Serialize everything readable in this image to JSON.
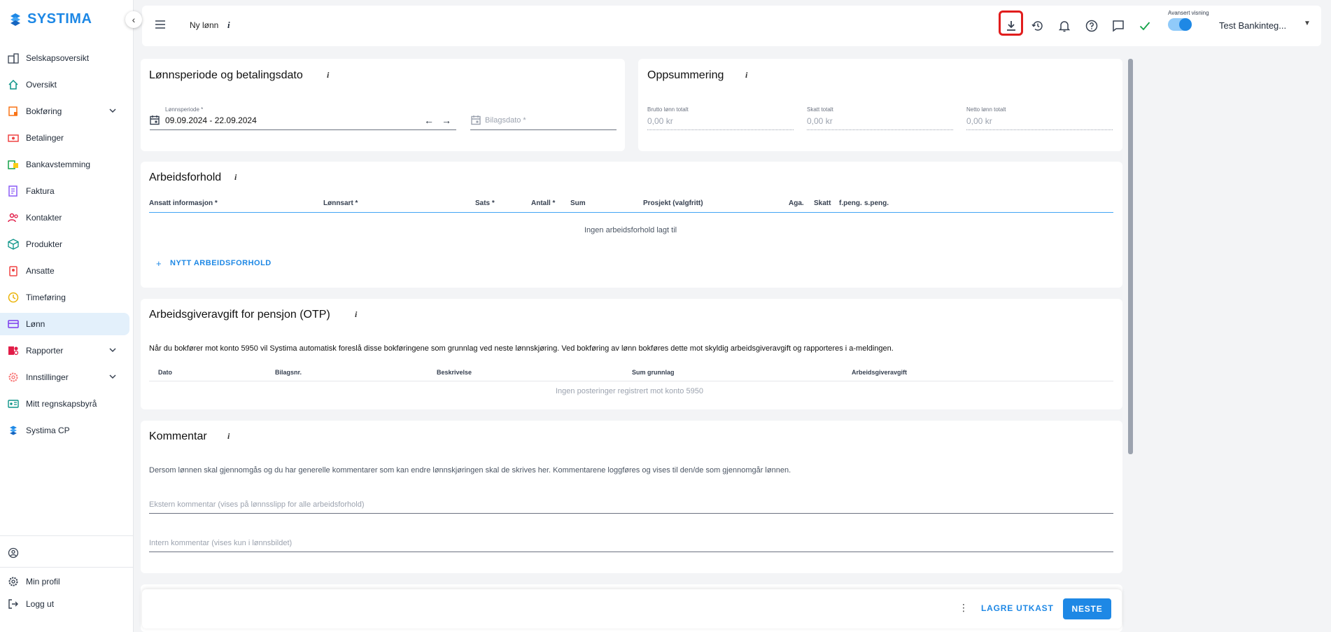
{
  "app": {
    "logo_text": "SYSTIMA"
  },
  "sidebar": {
    "items": [
      {
        "label": "Selskapsoversikt",
        "icon": "building-icon"
      },
      {
        "label": "Oversikt",
        "icon": "home-icon"
      },
      {
        "label": "Bokføring",
        "icon": "bookkeeping-icon",
        "expandable": true
      },
      {
        "label": "Betalinger",
        "icon": "payments-icon"
      },
      {
        "label": "Bankavstemming",
        "icon": "bank-icon"
      },
      {
        "label": "Faktura",
        "icon": "invoice-icon"
      },
      {
        "label": "Kontakter",
        "icon": "contacts-icon"
      },
      {
        "label": "Produkter",
        "icon": "product-box-icon"
      },
      {
        "label": "Ansatte",
        "icon": "employee-badge-icon"
      },
      {
        "label": "Timeføring",
        "icon": "clock-icon"
      },
      {
        "label": "Lønn",
        "icon": "card-icon",
        "active": true
      },
      {
        "label": "Rapporter",
        "icon": "reports-icon",
        "expandable": true
      },
      {
        "label": "Innstillinger",
        "icon": "settings-gear-icon",
        "expandable": true
      },
      {
        "label": "Mitt regnskapsbyrå",
        "icon": "id-card-icon"
      },
      {
        "label": "Systima CP",
        "icon": "systima-logo-icon"
      }
    ],
    "bottom": {
      "profile": "Min profil",
      "logout": "Logg ut"
    }
  },
  "topbar": {
    "title": "Ny lønn",
    "info": "i",
    "toggle_label": "Avansert visning",
    "toggle_on": true,
    "user": "Test Bankinteg...",
    "highlight_color": "#e11d1d"
  },
  "period_card": {
    "title": "Lønnsperiode og betalingsdato",
    "info": "i",
    "period_label": "Lønnsperiode *",
    "period_value": "09.09.2024 - 22.09.2024",
    "voucher_date_placeholder": "Bilagsdato *"
  },
  "summary_card": {
    "title": "Oppsummering",
    "info": "i",
    "gross_label": "Brutto lønn totalt",
    "gross_value": "0,00 kr",
    "tax_label": "Skatt totalt",
    "tax_value": "0,00 kr",
    "net_label": "Netto lønn totalt",
    "net_value": "0,00 kr"
  },
  "employment_card": {
    "title": "Arbeidsforhold",
    "info": "i",
    "columns": [
      "Ansatt informasjon *",
      "Lønnsart *",
      "Sats *",
      "Antall *",
      "Sum",
      "Prosjekt (valgfritt)",
      "Aga.",
      "Skatt",
      "f.peng.",
      "s.peng."
    ],
    "empty": "Ingen arbeidsforhold lagt til",
    "add_button": "NYTT ARBEIDSFORHOLD"
  },
  "otp_card": {
    "title": "Arbeidsgiveravgift for pensjon (OTP)",
    "info": "i",
    "description": "Når du bokfører mot konto 5950 vil Systima automatisk foreslå disse bokføringene som grunnlag ved neste lønnskjøring. Ved bokføring av lønn bokføres dette mot skyldig arbeidsgiveravgift og rapporteres i a-meldingen.",
    "columns": [
      "Dato",
      "Bilagsnr.",
      "Beskrivelse",
      "Sum grunnlag",
      "Arbeidsgiveravgift"
    ],
    "empty": "Ingen posteringer registrert mot konto 5950"
  },
  "comment_card": {
    "title": "Kommentar",
    "info": "i",
    "description": "Dersom lønnen skal gjennomgås og du har generelle kommentarer som kan endre lønnskjøringen skal de skrives her. Kommentarene loggføres og vises til den/de som gjennomgår lønnen.",
    "external_placeholder": "Ekstern kommentar (vises på lønnsslipp for alle arbeidsforhold)",
    "internal_placeholder": "Intern kommentar (vises kun i lønnsbildet)"
  },
  "footer": {
    "save_draft": "LAGRE UTKAST",
    "next": "NESTE"
  }
}
